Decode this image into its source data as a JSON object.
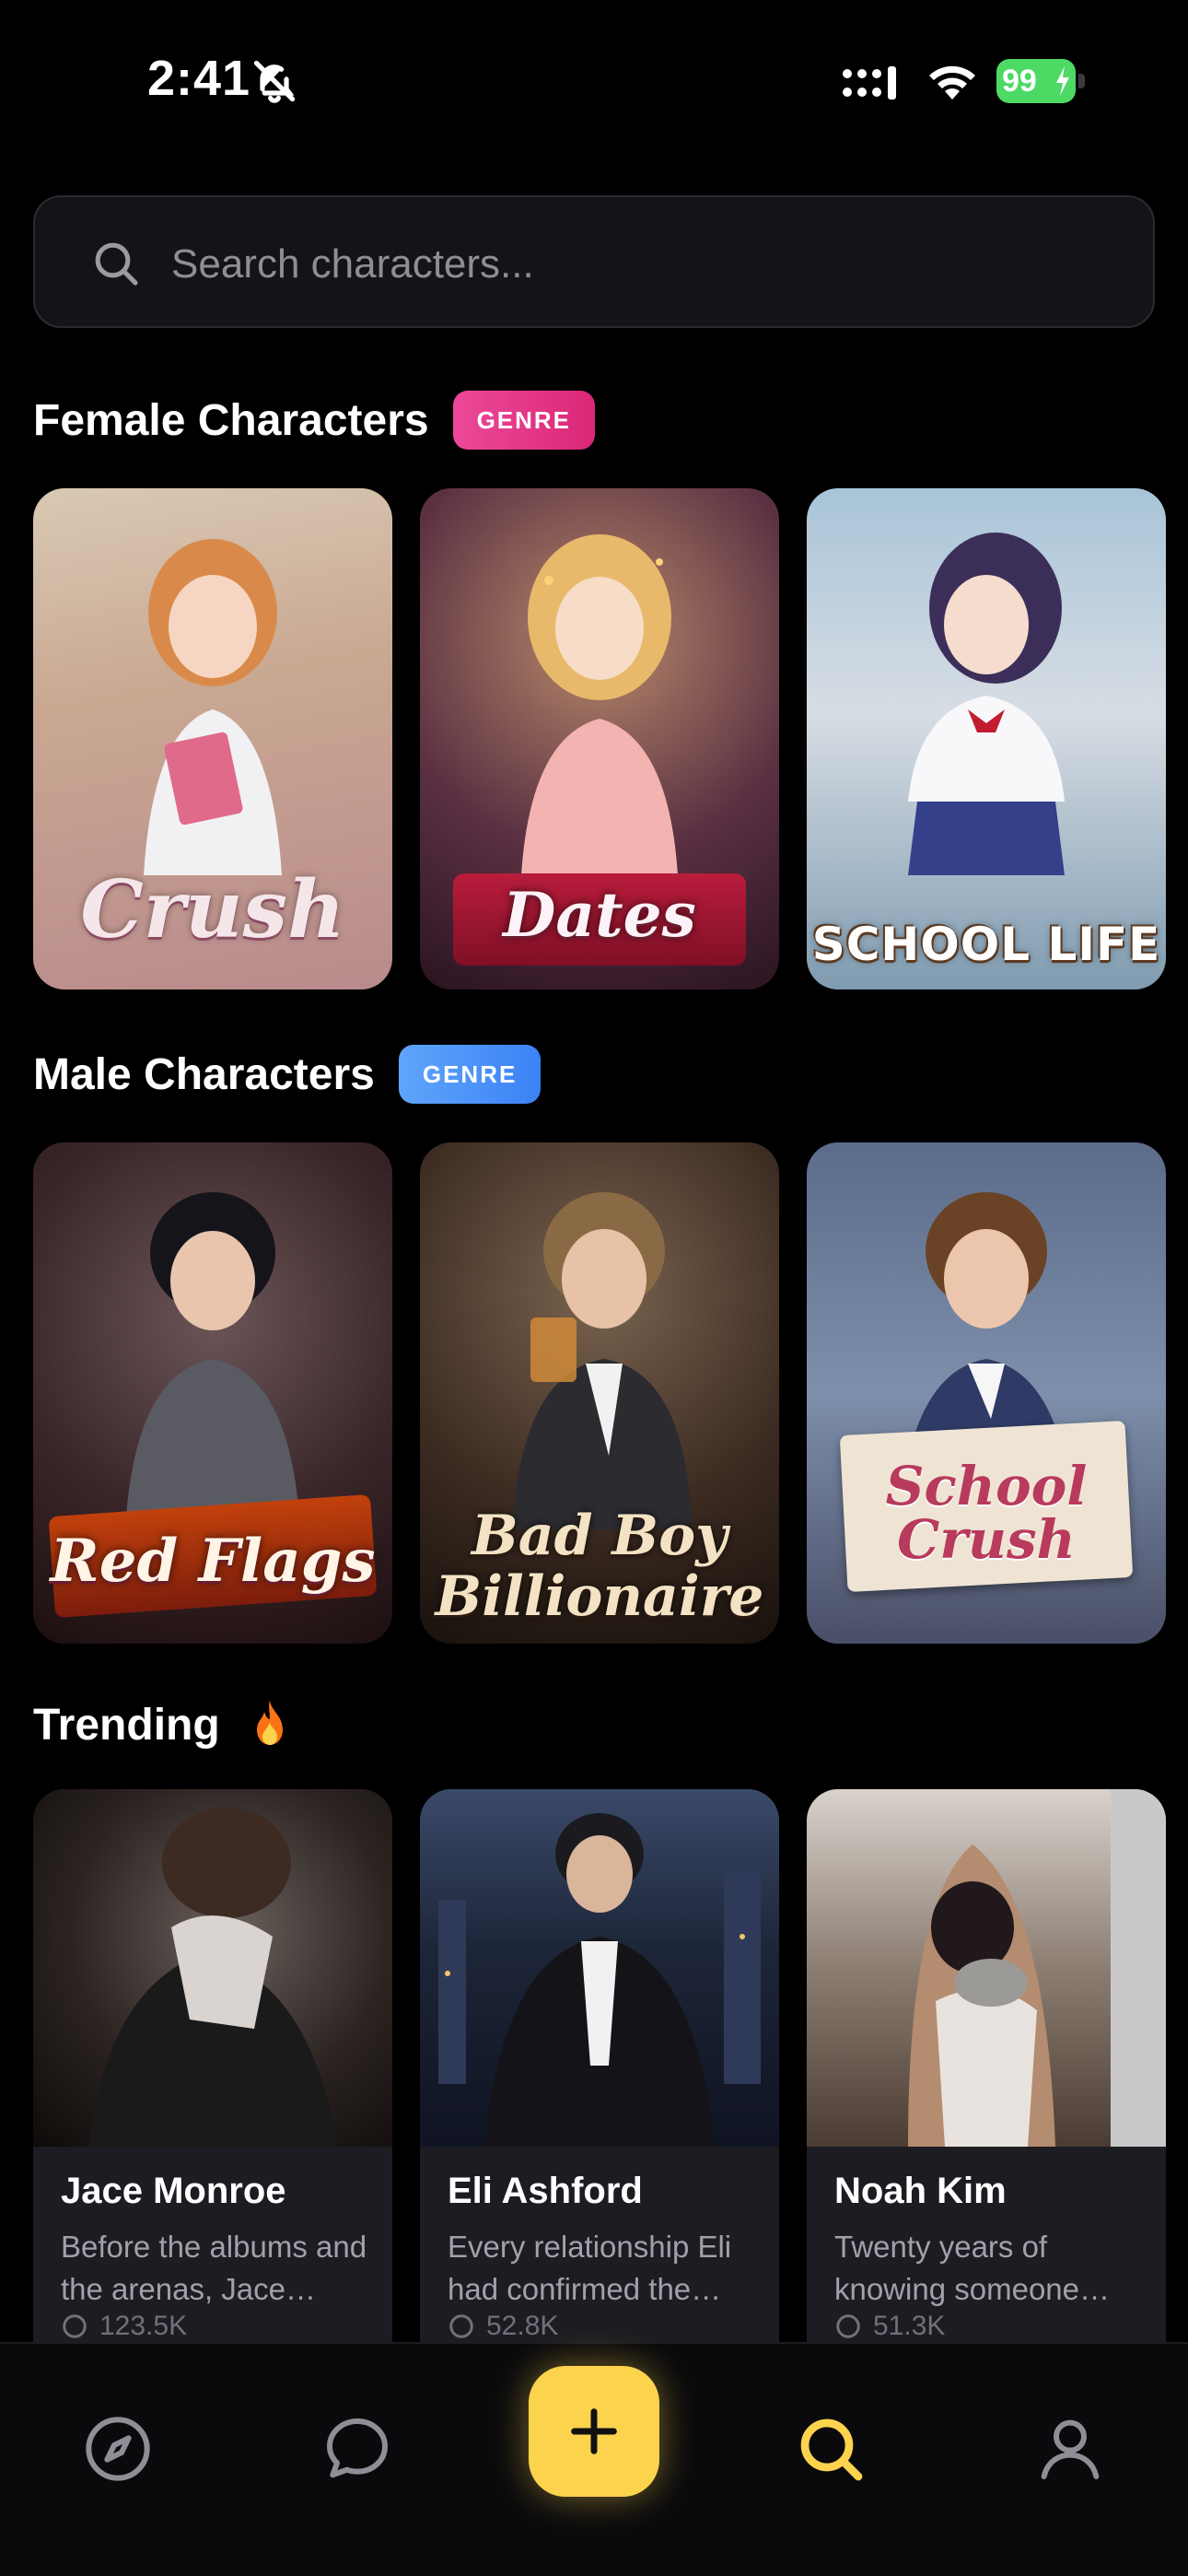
{
  "status_bar": {
    "time": "2:41",
    "battery": "99"
  },
  "search": {
    "placeholder": "Search characters..."
  },
  "sections": {
    "female": {
      "title": "Female Characters",
      "badge": "GENRE",
      "cards": [
        {
          "label": "Crush"
        },
        {
          "label": "Dates"
        },
        {
          "label": "SCHOOL LIFE"
        }
      ]
    },
    "male": {
      "title": "Male Characters",
      "badge": "GENRE",
      "cards": [
        {
          "label": "Red Flags"
        },
        {
          "label": "Bad Boy Billionaire"
        },
        {
          "label": "School Crush"
        }
      ]
    },
    "trending": {
      "title": "Trending",
      "icon": "fire-icon",
      "cards": [
        {
          "name": "Jace Monroe",
          "description": "Before the albums and the arenas, Jace Monroe was just a boy with a guitar.",
          "chats": "123.5K"
        },
        {
          "name": "Eli Ashford",
          "description": "Every relationship Eli had confirmed the same thing.",
          "chats": "52.8K"
        },
        {
          "name": "Noah Kim",
          "description": "Twenty years of knowing someone changes everything.",
          "chats": "51.3K"
        }
      ]
    }
  },
  "bottom_nav": {
    "items": [
      "compass-icon",
      "chat-icon",
      "plus-icon",
      "search-icon",
      "profile-icon"
    ],
    "active": "search-icon"
  },
  "colors": {
    "accent": "#fcd34d",
    "female_badge": "#ec4899",
    "male_badge": "#3b82f6",
    "background": "#000000"
  }
}
